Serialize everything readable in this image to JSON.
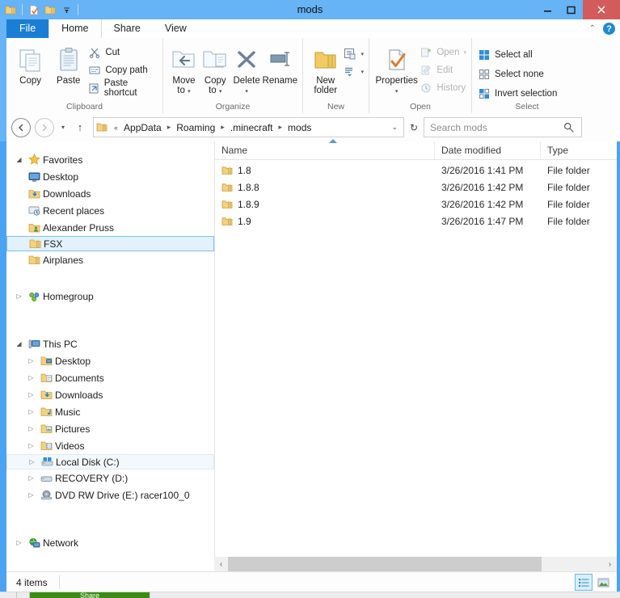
{
  "window": {
    "title": "mods",
    "quick_access": [
      "folder-icon",
      "properties-icon",
      "folder-up-icon",
      "customize-caret-icon"
    ],
    "controls": {
      "minimize": "–",
      "maximize": "❒",
      "close": "✕"
    },
    "titlebar_color": "#66b3f5",
    "close_color": "#d45b5b"
  },
  "tabs": [
    {
      "label": "File",
      "type": "file"
    },
    {
      "label": "Home",
      "type": "active"
    },
    {
      "label": "Share",
      "type": "normal"
    },
    {
      "label": "View",
      "type": "normal"
    }
  ],
  "tabstrip_right": {
    "collapse": "⌃",
    "help": "?"
  },
  "ribbon": {
    "groups": [
      {
        "label": "Clipboard",
        "big": [
          {
            "label": "Copy",
            "icon": "copy-icon"
          },
          {
            "label": "Paste",
            "icon": "paste-icon"
          }
        ],
        "small": [
          {
            "label": "Cut",
            "icon": "scissors-icon",
            "disabled": false
          },
          {
            "label": "Copy path",
            "icon": "copy-path-icon",
            "disabled": false
          },
          {
            "label": "Paste shortcut",
            "icon": "paste-shortcut-icon",
            "disabled": false
          }
        ]
      },
      {
        "label": "Organize",
        "big": [
          {
            "label": "Move\nto",
            "icon": "move-to-icon",
            "caret": true
          },
          {
            "label": "Copy\nto",
            "icon": "copy-to-icon",
            "caret": true
          },
          {
            "label": "Delete",
            "icon": "delete-x-icon",
            "caret": true
          },
          {
            "label": "Rename",
            "icon": "rename-icon",
            "caret": false
          }
        ]
      },
      {
        "label": "New",
        "big": [
          {
            "label": "New\nfolder",
            "icon": "new-folder-icon"
          }
        ],
        "small": [
          {
            "label": "",
            "icon": "new-item-icon",
            "caret": true
          },
          {
            "label": "",
            "icon": "easy-access-icon",
            "caret": true
          }
        ]
      },
      {
        "label": "Open",
        "big": [
          {
            "label": "Properties",
            "icon": "properties-icon",
            "caret": true
          }
        ],
        "small": [
          {
            "label": "Open",
            "icon": "open-icon",
            "disabled": true,
            "caret": true
          },
          {
            "label": "Edit",
            "icon": "edit-icon",
            "disabled": true
          },
          {
            "label": "History",
            "icon": "history-icon",
            "disabled": true
          }
        ]
      },
      {
        "label": "Select",
        "small": [
          {
            "label": "Select all",
            "icon": "select-all-icon",
            "disabled": false
          },
          {
            "label": "Select none",
            "icon": "select-none-icon",
            "disabled": false
          },
          {
            "label": "Invert selection",
            "icon": "invert-selection-icon",
            "disabled": false
          }
        ]
      }
    ]
  },
  "addressbar": {
    "back": "‹",
    "forward": "›",
    "history": "▾",
    "up": "↑",
    "root_prefix": "«",
    "crumbs": [
      "AppData",
      "Roaming",
      ".minecraft",
      "mods"
    ],
    "separator": "▸",
    "dropdown": "⌄",
    "refresh": "↻"
  },
  "search": {
    "placeholder": "Search mods",
    "value": "",
    "icon": "search-icon"
  },
  "navpane": {
    "sections": [
      {
        "name": "Favorites",
        "icon": "star-icon",
        "expander": "◢",
        "expanded": true,
        "items": [
          {
            "label": "Desktop",
            "icon": "desktop-icon",
            "state": "normal"
          },
          {
            "label": "Downloads",
            "icon": "downloads-folder-icon",
            "state": "normal"
          },
          {
            "label": "Recent places",
            "icon": "recent-places-icon",
            "state": "normal"
          },
          {
            "label": "Alexander Pruss",
            "icon": "user-folder-icon",
            "state": "normal"
          },
          {
            "label": "FSX",
            "icon": "folder-icon",
            "state": "selected"
          },
          {
            "label": "Airplanes",
            "icon": "folder-icon",
            "state": "normal"
          }
        ]
      },
      {
        "name": "Homegroup",
        "icon": "homegroup-icon",
        "expander": "▷",
        "expanded": false,
        "items": []
      },
      {
        "name": "This PC",
        "icon": "this-pc-icon",
        "expander": "◢",
        "expanded": true,
        "items": [
          {
            "label": "Desktop",
            "icon": "desktop-folder-icon",
            "state": "normal",
            "expander": "▷"
          },
          {
            "label": "Documents",
            "icon": "documents-folder-icon",
            "state": "normal",
            "expander": "▷"
          },
          {
            "label": "Downloads",
            "icon": "downloads-folder-icon",
            "state": "normal",
            "expander": "▷"
          },
          {
            "label": "Music",
            "icon": "music-folder-icon",
            "state": "normal",
            "expander": "▷"
          },
          {
            "label": "Pictures",
            "icon": "pictures-folder-icon",
            "state": "normal",
            "expander": "▷"
          },
          {
            "label": "Videos",
            "icon": "videos-folder-icon",
            "state": "normal",
            "expander": "▷"
          },
          {
            "label": "Local Disk (C:)",
            "icon": "local-disk-icon",
            "state": "hover",
            "expander": "▷"
          },
          {
            "label": "RECOVERY (D:)",
            "icon": "drive-icon",
            "state": "normal",
            "expander": "▷"
          },
          {
            "label": "DVD RW Drive (E:) racer100_0",
            "icon": "dvd-drive-icon",
            "state": "normal",
            "expander": "▷"
          }
        ]
      },
      {
        "name": "Network",
        "icon": "network-icon",
        "expander": "▷",
        "expanded": false,
        "items": []
      }
    ]
  },
  "filelist": {
    "columns": [
      {
        "key": "name",
        "label": "Name",
        "sorted": "asc"
      },
      {
        "key": "date",
        "label": "Date modified",
        "sorted": null
      },
      {
        "key": "type",
        "label": "Type",
        "sorted": null
      }
    ],
    "rows": [
      {
        "name": "1.8",
        "date": "3/26/2016 1:41 PM",
        "type": "File folder",
        "icon": "folder-icon"
      },
      {
        "name": "1.8.8",
        "date": "3/26/2016 1:42 PM",
        "type": "File folder",
        "icon": "folder-icon"
      },
      {
        "name": "1.8.9",
        "date": "3/26/2016 1:42 PM",
        "type": "File folder",
        "icon": "folder-icon"
      },
      {
        "name": "1.9",
        "date": "3/26/2016 1:47 PM",
        "type": "File folder",
        "icon": "folder-icon"
      }
    ]
  },
  "hscroll": {
    "left_arrow": "‹",
    "right_arrow": "›"
  },
  "statusbar": {
    "item_count": "4 items",
    "views": [
      {
        "name": "details-view-icon",
        "active": true
      },
      {
        "name": "large-icons-view-icon",
        "active": false
      }
    ]
  },
  "background_window": {
    "label": "Share"
  }
}
